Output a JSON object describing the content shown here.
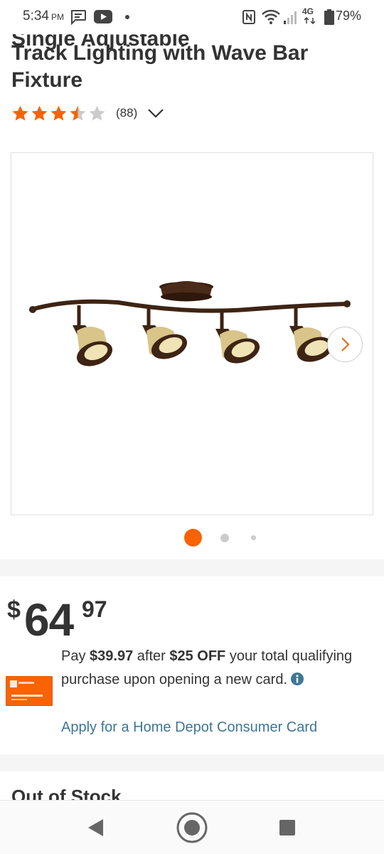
{
  "status_bar": {
    "time": "5:34",
    "ampm": "PM",
    "network": "4G",
    "battery": "79%"
  },
  "product": {
    "title_partial": "Single Adjustable",
    "title": "Track Lighting with Wave Bar Fixture",
    "rating": 3.5,
    "review_count": "(88)"
  },
  "gallery": {
    "image_name": "track-light-fixture-image",
    "image_count": 3,
    "active_index": 0
  },
  "price": {
    "dollar_sign": "$",
    "whole": "64",
    "cents": "97"
  },
  "promo": {
    "pay_prefix": "Pay ",
    "discounted_price": "$39.97",
    "after_text": " after ",
    "off_amount": "$25 OFF",
    "suffix_text": " your total qualifying purchase upon opening a new card.",
    "apply_link": "Apply for a Home Depot Consumer Card"
  },
  "availability": {
    "title": "Out of Stock"
  },
  "colors": {
    "brand_orange": "#f96302",
    "link_blue": "#3e7697",
    "star_gray": "#cccccc"
  },
  "icons": [
    "message-icon",
    "youtube-icon",
    "nfc-icon",
    "wifi-icon",
    "signal-icon",
    "battery-icon",
    "info-icon",
    "chevron-right-icon",
    "back-icon",
    "home-icon",
    "recents-icon"
  ]
}
